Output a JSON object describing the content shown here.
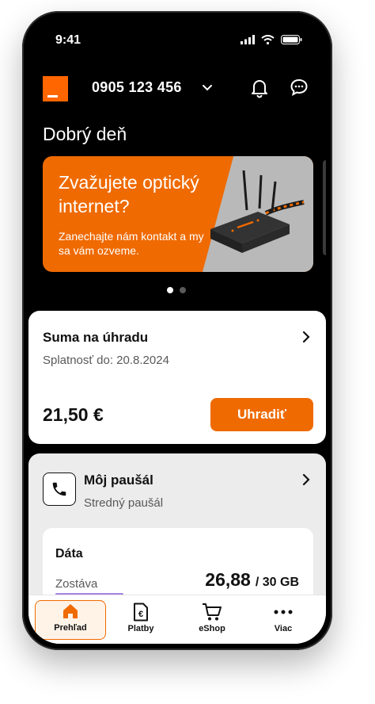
{
  "status_bar": {
    "time": "9:41"
  },
  "header": {
    "phone_number": "0905 123 456"
  },
  "greeting": "Dobrý deň",
  "banner": {
    "title": "Zvažujete optický internet?",
    "subtitle": "Zanechajte nám kontakt a my sa vám ozveme.",
    "colors": {
      "primary": "#ef6a00",
      "secondary": "#b9b9b9"
    },
    "pagination": {
      "total": 2,
      "active": 1
    }
  },
  "payment_card": {
    "title": "Suma na úhradu",
    "due": "Splatnosť do: 20.8.2024",
    "amount": "21,50 €",
    "button_label": "Uhradiť"
  },
  "plan_card": {
    "title": "Môj paušál",
    "plan_name": "Stredný paušál",
    "data": {
      "title": "Dáta",
      "remaining_label": "Zostáva",
      "remaining_value": "26,88",
      "total": "/ 30 GB",
      "progress_fraction": 0.896
    }
  },
  "bottom_nav": {
    "items": [
      {
        "label": "Prehľad",
        "icon": "home-icon",
        "active": true
      },
      {
        "label": "Platby",
        "icon": "euro-document-icon",
        "active": false
      },
      {
        "label": "eShop",
        "icon": "cart-icon",
        "active": false
      },
      {
        "label": "Viac",
        "icon": "more-dots-icon",
        "active": false
      }
    ]
  },
  "accent_color": "#ef6a00"
}
